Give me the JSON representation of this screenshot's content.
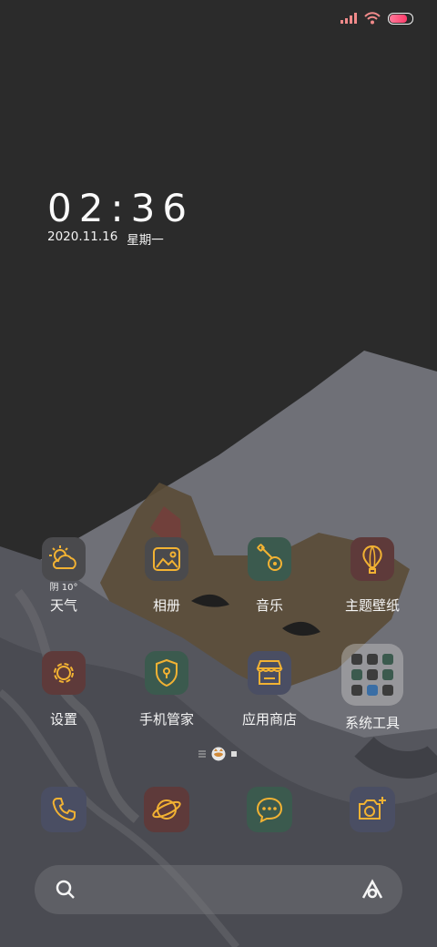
{
  "status": {
    "battery_level": 0.8
  },
  "lockclock": {
    "time": "02:36",
    "date": "2020.11.16",
    "weekday": "星期一"
  },
  "weather": {
    "condition": "阴",
    "temp": "10°"
  },
  "apps": [
    {
      "label": "天气",
      "icon": "weather-icon"
    },
    {
      "label": "相册",
      "icon": "gallery-icon"
    },
    {
      "label": "音乐",
      "icon": "guitar-icon"
    },
    {
      "label": "主题壁纸",
      "icon": "balloon-icon"
    },
    {
      "label": "设置",
      "icon": "gear-icon"
    },
    {
      "label": "手机管家",
      "icon": "shield-icon"
    },
    {
      "label": "应用商店",
      "icon": "store-icon"
    },
    {
      "label": "系统工具",
      "icon": "folder-icon"
    }
  ],
  "dock": [
    {
      "icon": "phone-icon"
    },
    {
      "icon": "browser-icon"
    },
    {
      "icon": "message-icon"
    },
    {
      "icon": "camera-icon"
    }
  ],
  "search": {
    "icon": "search-icon",
    "assistant": "assistant-icon"
  },
  "colors": {
    "accent": "#f2b233",
    "ear": "#6b5a3e"
  }
}
